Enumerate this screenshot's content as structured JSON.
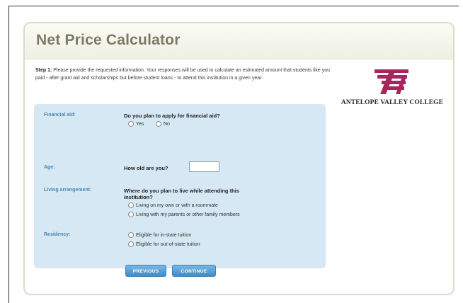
{
  "page": {
    "title": "Net Price Calculator"
  },
  "intro": {
    "step_label": "Step 1:",
    "text": "Please provide the requested information. Your responses will be used to calculate an estimated amount that students like you paid - after grant aid and scholarships but before student loans - to attend this institution in a given year."
  },
  "logo": {
    "name": "ANTELOPE VALLEY COLLEGE",
    "color": "#a8265e"
  },
  "form": {
    "financial_aid": {
      "label": "Financial aid:",
      "question": "Do you plan to apply for financial aid?",
      "options": [
        "Yes",
        "No"
      ]
    },
    "age": {
      "label": "Age:",
      "question": "How old are you?",
      "value": ""
    },
    "living": {
      "label": "Living arrangement:",
      "question_line1": "Where do you plan to live while attending this",
      "question_line2": "institution?",
      "options": [
        "Living on my own or with a roommate",
        "Living with my parents or other family members"
      ]
    },
    "residency": {
      "label": "Residency:",
      "options": [
        "Eligible for in-state tuition",
        "Eligible for out-of-state tuition"
      ]
    }
  },
  "buttons": {
    "previous": "PREVIOUS",
    "continue": "CONTINUE"
  },
  "colors": {
    "panel": "#d6e8f3",
    "label": "#4b87b3",
    "button": "#3f8cc8"
  }
}
